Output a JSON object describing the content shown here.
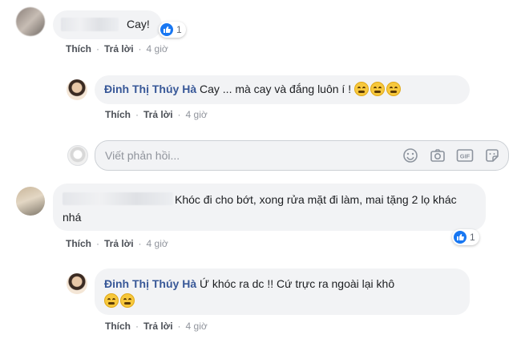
{
  "comments": [
    {
      "text": "Cay!",
      "reaction_count": "1",
      "actions": {
        "like": "Thích",
        "reply": "Trả lời",
        "time": "4 giờ"
      }
    },
    {
      "text": "Khóc đi cho bớt, xong rửa mặt đi làm, mai tặng 2 lọ khác nhá",
      "reaction_count": "1",
      "actions": {
        "like": "Thích",
        "reply": "Trả lời",
        "time": "4 giờ"
      }
    }
  ],
  "replies": [
    {
      "author": "Đinh Thị Thúy Hà",
      "text": "Cay ... mà cay và đắng luôn í !",
      "actions": {
        "like": "Thích",
        "reply": "Trả lời",
        "time": "4 giờ"
      }
    },
    {
      "author": "Đinh Thị Thúy Hà",
      "text": "Ứ khóc ra dc !! Cứ trực ra ngoài lại khô",
      "actions": {
        "like": "Thích",
        "reply": "Trả lời",
        "time": "4 giờ"
      }
    }
  ],
  "reply_box": {
    "placeholder": "Viết phản hồi..."
  },
  "icons": [
    "like-icon",
    "emoji-icon",
    "camera-icon",
    "gif-icon",
    "sticker-icon"
  ],
  "colors": {
    "author_name": "#385898",
    "like_blue": "#1877f2",
    "bubble_bg": "#f2f3f5"
  }
}
